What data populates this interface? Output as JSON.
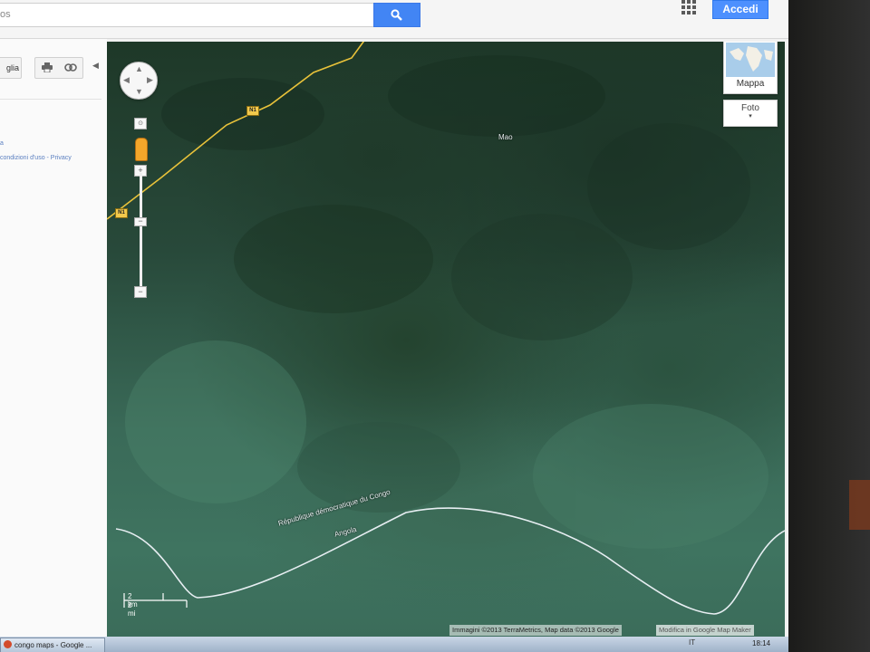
{
  "search": {
    "value": "os",
    "button_icon": "magnifier-icon"
  },
  "header": {
    "apps_icon": "grid-apps-icon",
    "signin_label": "Accedi",
    "accent": "#4285f4"
  },
  "left_panel": {
    "button_label": "glia",
    "print_icon": "printer-icon",
    "link_icon": "link-icon",
    "collapse_icon": "chevron-left-icon",
    "link_a": "a",
    "footer_links": "condizioni d'uso - Privacy"
  },
  "map": {
    "labels": {
      "town": "Mao",
      "country_north": "République démocratique du Congo",
      "country_south": "Angola"
    },
    "road_shields": [
      "N1",
      "N1"
    ],
    "toggle_label": "Mappa",
    "photo_label": "Foto",
    "photo_caret": "▾",
    "scale": {
      "metric": "2 km",
      "imperial": "2 mi"
    },
    "copyright": "Immagini ©2013 TerraMetrics, Map data ©2013 Google",
    "report": "Modifica in Google Map Maker"
  },
  "nav": {
    "pan_icon": "pan-control-icon",
    "compass": "⊙",
    "pegman_icon": "pegman-icon",
    "zoom_in": "+",
    "zoom_out": "−"
  },
  "taskbar": {
    "task_label": "congo maps - Google ...",
    "tray_text": "IT",
    "clock": "18:14"
  }
}
